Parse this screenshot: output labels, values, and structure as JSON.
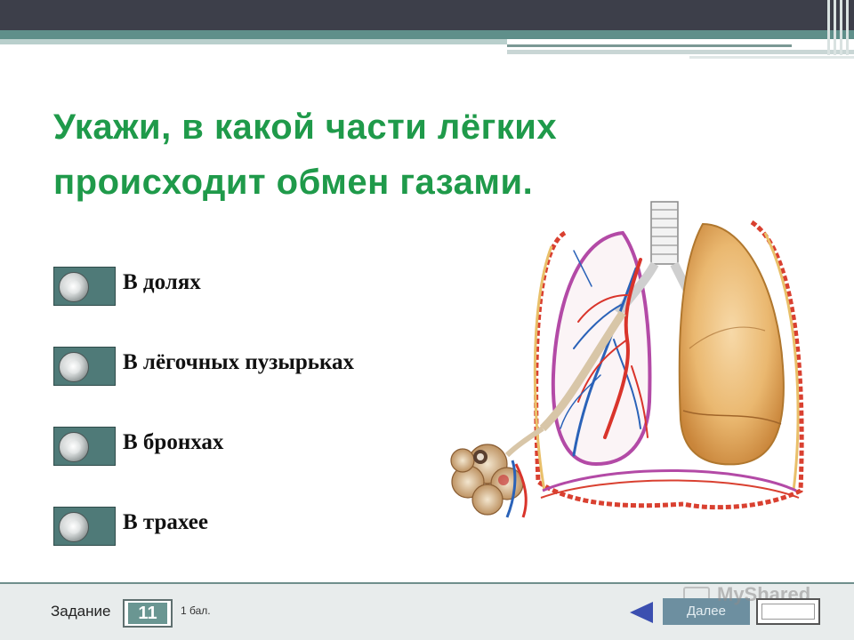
{
  "slide": {
    "question": "Укажи, в  какой части лёгких происходит обмен газами."
  },
  "options": [
    {
      "label": "В долях"
    },
    {
      "label": "В лёгочных пузырьках"
    },
    {
      "label": "В бронхах"
    },
    {
      "label": "В трахее"
    }
  ],
  "footer": {
    "task_label": "Задание",
    "task_number": "11",
    "points": "1 бал.",
    "next_label": "Далее",
    "watermark": "MyShared"
  },
  "icons": {
    "option_radio": "radio-knob-icon",
    "prev": "triangle-left-icon",
    "illustration": "lungs-illustration"
  },
  "colors": {
    "question_text": "#1f9a4a",
    "option_button": "#4f7a78",
    "header_dark": "#3d3f4a",
    "header_teal": "#5f8f8a",
    "prev_arrow": "#3b4fb0",
    "next_button": "#6d8fa0"
  }
}
